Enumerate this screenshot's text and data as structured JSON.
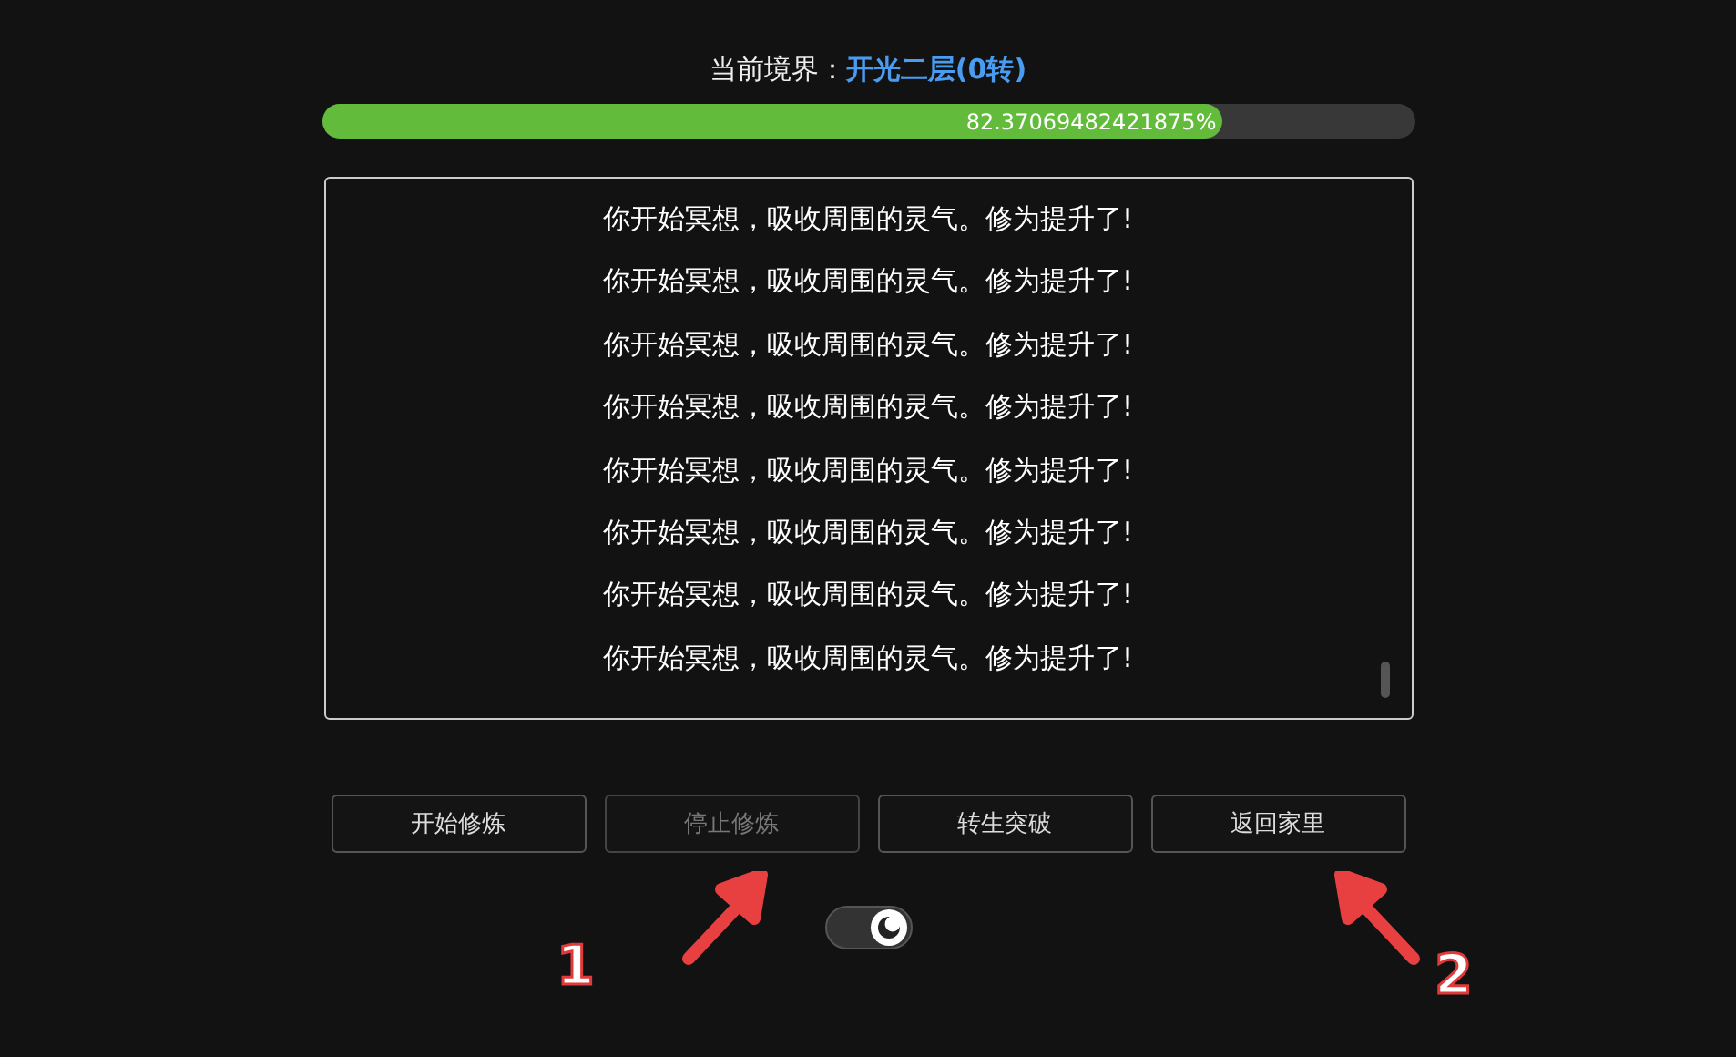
{
  "realm": {
    "label": "当前境界：",
    "value": "开光二层(0转)"
  },
  "progress": {
    "level": 0.8237069482421875,
    "reading": "82.37069482421875%"
  },
  "log": [
    "你开始冥想，吸收周围的灵气。修为提升了!",
    "你开始冥想，吸收周围的灵气。修为提升了!",
    "你开始冥想，吸收周围的灵气。修为提升了!",
    "你开始冥想，吸收周围的灵气。修为提升了!",
    "你开始冥想，吸收周围的灵气。修为提升了!",
    "你开始冥想，吸收周围的灵气。修为提升了!",
    "你开始冥想，吸收周围的灵气。修为提升了!",
    "你开始冥想，吸收周围的灵气。修为提升了!"
  ],
  "buttons": [
    {
      "label": "开始修炼",
      "disabled": false
    },
    {
      "label": "停止修炼",
      "disabled": true,
      "annotation": "1"
    },
    {
      "label": "转生突破",
      "disabled": false
    },
    {
      "label": "返回家里",
      "disabled": false,
      "annotation": "2"
    }
  ],
  "theme_toggle": {
    "on": true
  }
}
